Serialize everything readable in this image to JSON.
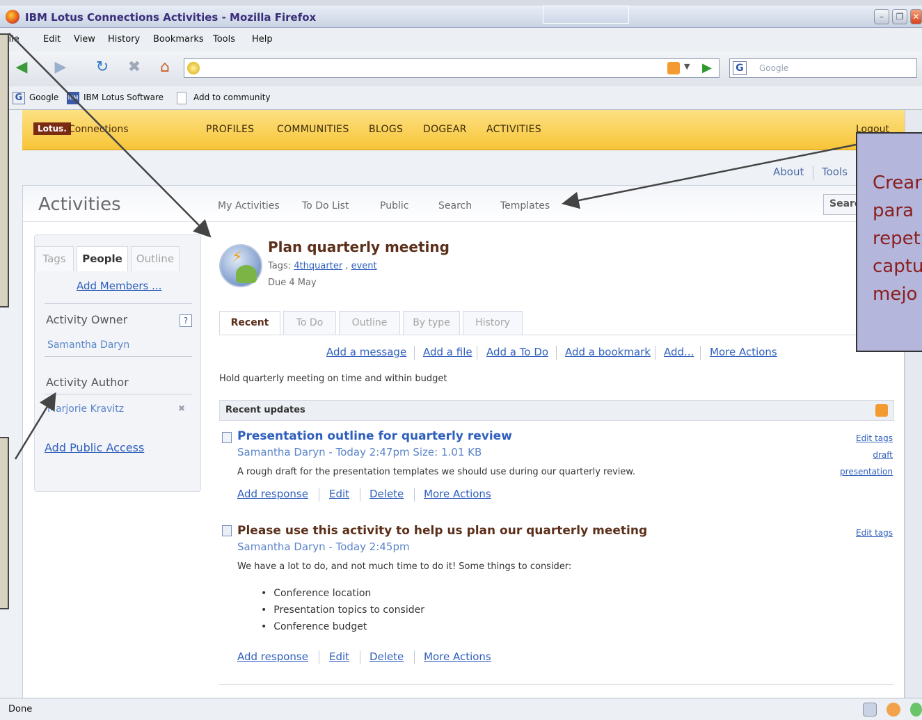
{
  "window": {
    "title": "IBM Lotus Connections Activities - Mozilla Firefox"
  },
  "menu": [
    "File",
    "Edit",
    "View",
    "History",
    "Bookmarks",
    "Tools",
    "Help"
  ],
  "search_engine": {
    "placeholder": "Google"
  },
  "bookmarks": [
    "Google",
    "IBM Lotus Software",
    "Add to community"
  ],
  "lotus": {
    "logo": "Lotus.",
    "product": "Connections",
    "nav": [
      "PROFILES",
      "COMMUNITIES",
      "BLOGS",
      "DOGEAR",
      "ACTIVITIES"
    ],
    "logout": "Logout",
    "toplinks": [
      "About",
      "Tools"
    ]
  },
  "activities": {
    "heading": "Activities",
    "subnav": [
      "My Activities",
      "To Do List",
      "Public",
      "Search",
      "Templates"
    ],
    "search_button": "Search"
  },
  "sidebar": {
    "tabs": [
      "Tags",
      "People",
      "Outline"
    ],
    "add_members": "Add Members ...",
    "owner_label": "Activity Owner",
    "help": "?",
    "owner_name": "Samantha Daryn",
    "author_label": "Activity Author",
    "author_name": "Marjorie Kravitz",
    "public_access": "Add Public Access"
  },
  "activity": {
    "title": "Plan quarterly meeting",
    "tags_label": "Tags:",
    "tags": [
      "4thquarter",
      "event"
    ],
    "due": "Due 4 May",
    "tabs": [
      "Recent",
      "To Do",
      "Outline",
      "By type",
      "History"
    ],
    "actions": [
      "Add a message",
      "Add a file",
      "Add a To Do",
      "Add a bookmark",
      "Add...",
      "More Actions"
    ],
    "goal": "Hold quarterly meeting on time and within budget",
    "recent_label": "Recent updates"
  },
  "entries": [
    {
      "title": "Presentation outline for quarterly review",
      "meta": "Samantha Daryn - Today 2:47pm Size: 1.01 KB",
      "body": "A rough draft for the presentation templates we should use during our quarterly review.",
      "actions": [
        "Add response",
        "Edit",
        "Delete",
        "More Actions"
      ],
      "right": [
        "Edit tags",
        "draft",
        "presentation"
      ]
    },
    {
      "title": "Please use this activity to help us plan our quarterly meeting",
      "meta": "Samantha Daryn - Today 2:45pm",
      "body": "We have a lot to do, and not much time to do it! Some things to consider:",
      "bullets": [
        "Conference location",
        "Presentation topics to consider",
        "Conference budget"
      ],
      "actions": [
        "Add response",
        "Edit",
        "Delete",
        "More Actions"
      ],
      "right": [
        "Edit tags"
      ]
    }
  ],
  "callout_right": {
    "lines": [
      "Crear",
      "para",
      "repet",
      "captu",
      "mejo"
    ]
  },
  "status": {
    "text": "Done"
  },
  "colors": {
    "lotus_bar": "#f7c437",
    "link": "#2f5fbd",
    "title_brown": "#5b2f1a",
    "callout_bg": "#b4b6dc",
    "callout_text": "#8a1e1e"
  }
}
